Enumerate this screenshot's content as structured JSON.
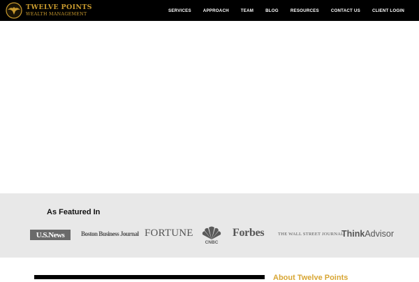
{
  "brand": {
    "title": "TWELVE POINTS",
    "subtitle": "WEALTH MANAGEMENT",
    "logo_icon": "eagle-crest-icon",
    "accent_color": "#c99a2e"
  },
  "nav": {
    "items": [
      {
        "label": "SERVICES"
      },
      {
        "label": "APPROACH"
      },
      {
        "label": "TEAM"
      },
      {
        "label": "BLOG"
      },
      {
        "label": "RESOURCES"
      },
      {
        "label": "CONTACT US"
      },
      {
        "label": "CLIENT LOGIN"
      }
    ]
  },
  "featured": {
    "heading": "As Featured In",
    "logos": {
      "usnews": "U.S.News",
      "bbj": "Boston Business Journal",
      "fortune": "FORTUNE",
      "cnbc": "CNBC",
      "forbes": "Forbes",
      "wsj": "THE WALL STREET JOURNAL.",
      "think": "Think",
      "advisor": "Advisor"
    }
  },
  "about": {
    "heading": "About Twelve Points",
    "heading_color": "#d8a634"
  }
}
